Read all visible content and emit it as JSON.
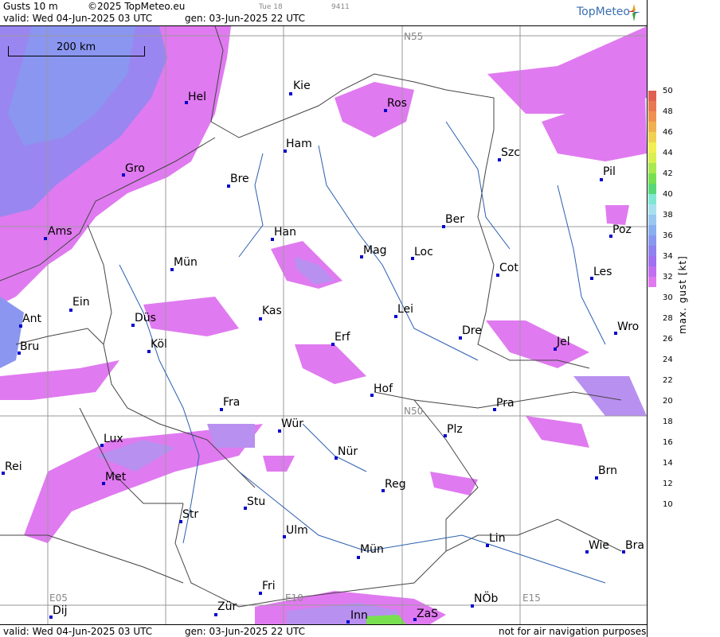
{
  "header": {
    "title": "Gusts 10 m",
    "copyright": "©2025 TopMeteo.eu",
    "tue": "Tue 18",
    "code": "9411",
    "valid": "valid:  Wed  04-Jun-2025  03 UTC",
    "gen": "gen: 03-Jun-2025 22 UTC",
    "logo": "TopMeteo"
  },
  "footer": {
    "valid": "valid:  Wed  04-Jun-2025  03 UTC",
    "gen": "gen: 03-Jun-2025 22 UTC",
    "note": "not for air navigation purposes"
  },
  "scale_label": "200 km",
  "grid_labels": {
    "n55": "N55",
    "n50": "N50",
    "e05": "E05",
    "e10": "E10",
    "e15": "E15"
  },
  "cities": {
    "hel": "Hel",
    "kie": "Kie",
    "ros": "Ros",
    "ham": "Ham",
    "szc": "Szc",
    "gro": "Gro",
    "bre": "Bre",
    "pil": "Pil",
    "ber": "Ber",
    "ams": "Ams",
    "han": "Han",
    "poz": "Poz",
    "mag": "Mag",
    "loc": "Loc",
    "mun_n": "Mün",
    "cot": "Cot",
    "les": "Les",
    "ein": "Ein",
    "kas": "Kas",
    "lei": "Lei",
    "ant": "Ant",
    "dus": "Düs",
    "dre": "Dre",
    "wro": "Wro",
    "erf": "Erf",
    "jel": "Jel",
    "bru": "Bru",
    "kol": "Köl",
    "hof": "Hof",
    "fra": "Fra",
    "pra": "Pra",
    "wur": "Wür",
    "lux": "Lux",
    "plz": "Plz",
    "nur": "Nür",
    "rei": "Rei",
    "met": "Met",
    "brn": "Brn",
    "reg": "Reg",
    "stu": "Stu",
    "str": "Str",
    "ulm": "Ulm",
    "lin": "Lin",
    "wie": "Wie",
    "bra": "Bra",
    "mun_s": "Mün",
    "fri": "Fri",
    "nob": "NÖb",
    "dij": "Dij",
    "zur": "Zür",
    "inn": "Inn",
    "zas": "ZaS"
  },
  "legend": {
    "title": "max. gust [kt]",
    "ticks": [
      "50",
      "48",
      "46",
      "44",
      "42",
      "40",
      "38",
      "36",
      "34",
      "32",
      "30",
      "28",
      "26",
      "24",
      "22",
      "20",
      "18",
      "16",
      "14",
      "12",
      "10"
    ],
    "colors": [
      "#e06050",
      "#e87850",
      "#f09050",
      "#f0b050",
      "#f0d050",
      "#f0f050",
      "#d8f050",
      "#a8e850",
      "#78e050",
      "#58d878",
      "#80e8d0",
      "#a8e0f0",
      "#98c8f0",
      "#88b0f0",
      "#8898f0",
      "#9080f0",
      "#a070f0",
      "#c070f0",
      "#e078f0"
    ]
  }
}
